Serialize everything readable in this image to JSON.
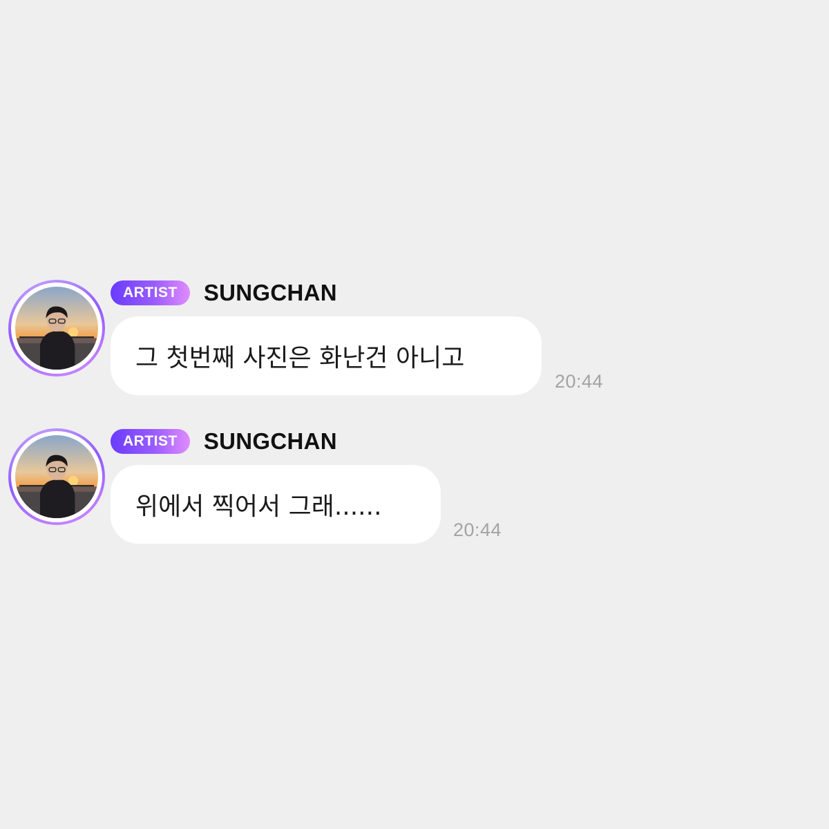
{
  "messages": [
    {
      "badge": "ARTIST",
      "sender": "SUNGCHAN",
      "text": "그 첫번째 사진은 화난건 아니고",
      "time": "20:44"
    },
    {
      "badge": "ARTIST",
      "sender": "SUNGCHAN",
      "text": "위에서 찍어서 그래......",
      "time": "20:44"
    }
  ],
  "colors": {
    "background": "#efefef",
    "bubble": "#ffffff",
    "badge_start": "#6a3cff",
    "badge_end": "#e08cff",
    "time_text": "#a3a3a3"
  },
  "icons": {
    "avatar": "profile-photo-sunset"
  }
}
